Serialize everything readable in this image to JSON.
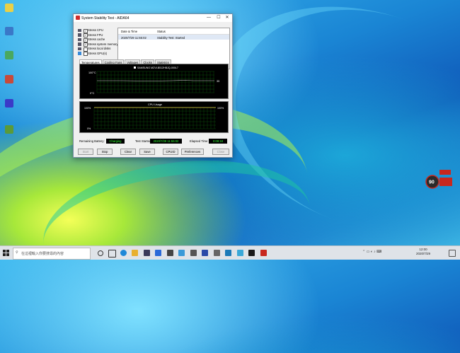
{
  "window": {
    "title": "System Stability Test - AIDA64",
    "minimize": "—",
    "maximize": "☐",
    "close": "✕"
  },
  "stress_options": [
    {
      "label": "Stress CPU",
      "checked": true
    },
    {
      "label": "Stress FPU",
      "checked": true
    },
    {
      "label": "Stress cache",
      "checked": true
    },
    {
      "label": "Stress system memory",
      "checked": true
    },
    {
      "label": "Stress local disks",
      "checked": false
    },
    {
      "label": "Stress GPU(s)",
      "checked": false
    }
  ],
  "log": {
    "col_date": "Date & Time",
    "col_status": "Status",
    "rows": [
      {
        "date": "2020/7/29 11:55:02",
        "status": "Stability Test: Started"
      }
    ]
  },
  "tabs": [
    "Temperatures",
    "Cooling Fans",
    "Voltages",
    "Clocks",
    "Statistics"
  ],
  "temp_graph": {
    "legend": "SAMSUNG MZVLB512HBJQ-000L7",
    "y_top": "100°C",
    "y_bottom": "0°C",
    "right_value": "35"
  },
  "cpu_graph": {
    "title": "CPU Usage",
    "y_top_left": "100%",
    "y_top_right": "100%",
    "y_bottom": "0%",
    "usage_fraction": 1.0
  },
  "status": {
    "battery_label": "Remaining Battery:",
    "battery_value": "Charging",
    "started_label": "Test Started:",
    "started_value": "2020/7/29 11:55:02",
    "elapsed_label": "Elapsed Time:",
    "elapsed_value": "0:09:18"
  },
  "buttons": {
    "start": "Start",
    "stop": "Stop",
    "clear": "Clear",
    "save": "Save",
    "cpuid": "CPUID",
    "preferences": "Preferences",
    "close": "Close"
  },
  "desktop_icons": [
    {
      "label": "",
      "color": "#e8d048"
    },
    {
      "label": "",
      "color": "#3a78c8"
    },
    {
      "label": "",
      "color": "#4aa860"
    },
    {
      "label": "",
      "color": "#c84a3a"
    },
    {
      "label": "",
      "color": "#3a3ac8"
    },
    {
      "label": "",
      "color": "#5a9a3a"
    }
  ],
  "widget": {
    "value": "90",
    "label_top": "",
    "label_side": ""
  },
  "taskbar": {
    "search_placeholder": "在這裡輸入你要搜尋的內容",
    "clock_time": "12:00",
    "clock_date": "2020/7/29"
  }
}
